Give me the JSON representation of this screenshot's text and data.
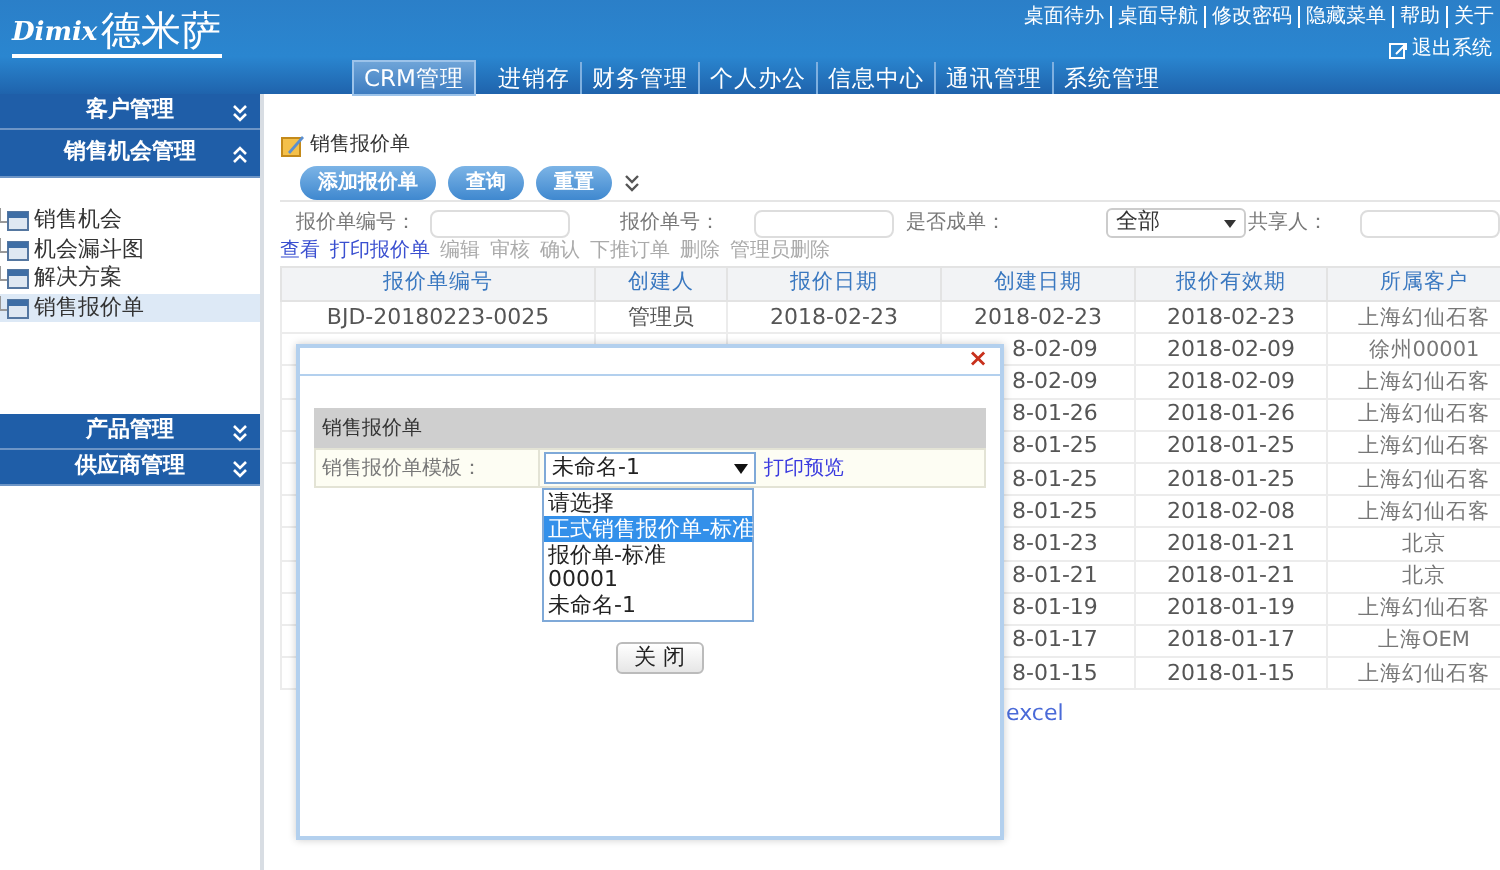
{
  "header": {
    "logo_brand": "Dimix",
    "logo_name": "德米萨",
    "top_links": [
      "桌面待办",
      "桌面导航",
      "修改密码",
      "隐藏菜单",
      "帮助",
      "关于"
    ],
    "logout": "退出系统",
    "nav_tabs": [
      {
        "label": "CRM管理",
        "selected": true
      },
      {
        "label": "进销存",
        "selected": false
      },
      {
        "label": "财务管理",
        "selected": false
      },
      {
        "label": "个人办公",
        "selected": false
      },
      {
        "label": "信息中心",
        "selected": false
      },
      {
        "label": "通讯管理",
        "selected": false
      },
      {
        "label": "系统管理",
        "selected": false
      }
    ]
  },
  "sidebar": {
    "sections": [
      {
        "label": "客户管理",
        "expanded": false
      },
      {
        "label": "销售机会管理",
        "expanded": true,
        "items": [
          {
            "label": "销售机会",
            "selected": false
          },
          {
            "label": "机会漏斗图",
            "selected": false
          },
          {
            "label": "解决方案",
            "selected": false
          },
          {
            "label": "销售报价单",
            "selected": true
          }
        ]
      },
      {
        "label": "产品管理",
        "expanded": false
      },
      {
        "label": "供应商管理",
        "expanded": false
      }
    ]
  },
  "page": {
    "title": "销售报价单",
    "buttons": [
      "添加报价单",
      "查询",
      "重置"
    ],
    "filters": [
      {
        "kind": "input",
        "label": "报价单编号："
      },
      {
        "kind": "input",
        "label": "报价单号："
      },
      {
        "kind": "select",
        "label": "是否成单：",
        "value": "全部"
      },
      {
        "kind": "input",
        "label": "共享人："
      }
    ],
    "actions": [
      {
        "label": "查看",
        "disabled": false
      },
      {
        "label": "打印报价单",
        "disabled": false
      },
      {
        "label": "编辑",
        "disabled": true
      },
      {
        "label": "审核",
        "disabled": true
      },
      {
        "label": "确认",
        "disabled": true
      },
      {
        "label": "下推订单",
        "disabled": true
      },
      {
        "label": "删除",
        "disabled": true
      },
      {
        "label": "管理员删除",
        "disabled": true
      }
    ],
    "table": {
      "columns": [
        "报价单编号",
        "创建人",
        "报价日期",
        "创建日期",
        "报价有效期",
        "所属客户"
      ],
      "rows": [
        {
          "kind": "full",
          "cells": [
            "BJD-20180223-0025",
            "管理员",
            "2018-02-23",
            "2018-02-23",
            "2018-02-23",
            "上海幻仙石客"
          ]
        },
        {
          "kind": "covered",
          "cells": [
            "8-02-09",
            "2018-02-09",
            "徐州00001"
          ]
        },
        {
          "kind": "covered",
          "cells": [
            "8-02-09",
            "2018-02-09",
            "上海幻仙石客"
          ]
        },
        {
          "kind": "covered",
          "cells": [
            "8-01-26",
            "2018-01-26",
            "上海幻仙石客"
          ]
        },
        {
          "kind": "covered",
          "cells": [
            "8-01-25",
            "2018-01-25",
            "上海幻仙石客"
          ]
        },
        {
          "kind": "covered",
          "cells": [
            "8-01-25",
            "2018-01-25",
            "上海幻仙石客"
          ]
        },
        {
          "kind": "covered",
          "cells": [
            "8-01-25",
            "2018-02-08",
            "上海幻仙石客"
          ]
        },
        {
          "kind": "covered",
          "cells": [
            "8-01-23",
            "2018-01-21",
            "北京"
          ]
        },
        {
          "kind": "covered",
          "cells": [
            "8-01-21",
            "2018-01-21",
            "北京"
          ]
        },
        {
          "kind": "covered",
          "cells": [
            "8-01-19",
            "2018-01-19",
            "上海幻仙石客"
          ]
        },
        {
          "kind": "covered",
          "cells": [
            "8-01-17",
            "2018-01-17",
            "上海OEM"
          ]
        },
        {
          "kind": "covered",
          "cells": [
            "8-01-15",
            "2018-01-15",
            "上海幻仙石客"
          ]
        }
      ]
    },
    "footer_link": "excel"
  },
  "dialog": {
    "close_icon": "×",
    "section_title": "销售报价单",
    "field_label": "销售报价单模板：",
    "select_value": "未命名-1",
    "options": [
      {
        "label": "请选择",
        "selected": false
      },
      {
        "label": "正式销售报价单-标准",
        "selected": true
      },
      {
        "label": "报价单-标准",
        "selected": false
      },
      {
        "label": "00001",
        "selected": false
      },
      {
        "label": "未命名-1",
        "selected": false
      }
    ],
    "link": "打印预览",
    "close_button": "关 闭"
  }
}
